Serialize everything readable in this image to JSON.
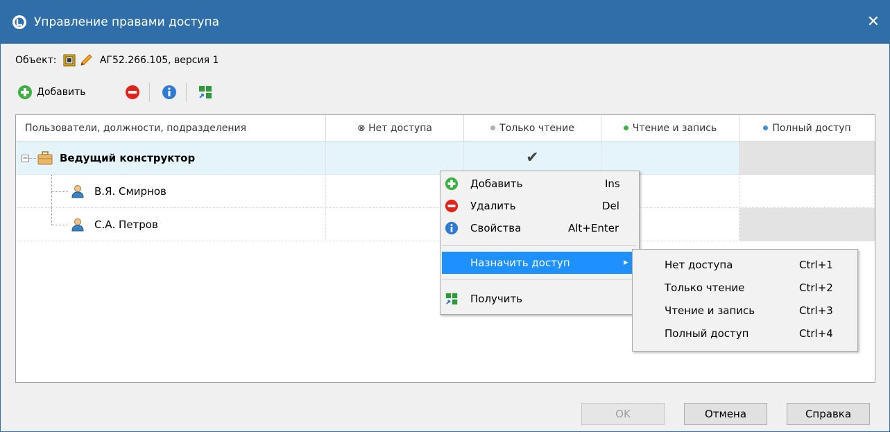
{
  "window": {
    "title": "Управление правами доступа",
    "close_glyph": "✕"
  },
  "object": {
    "label": "Объект:",
    "name": "АГ52.266.105, версия 1"
  },
  "toolbar": {
    "add_label": "Добавить"
  },
  "grid": {
    "columns": [
      "Пользователи, должности, подразделения",
      "⊗ Нет доступа",
      "Только чтение",
      "Чтение и запись",
      "Полный доступ"
    ],
    "rows": [
      {
        "name": "Ведущий конструктор",
        "check": "✔"
      },
      {
        "name": "В.Я. Смирнов"
      },
      {
        "name": "С.А. Петров"
      }
    ]
  },
  "context_menu": {
    "items": [
      {
        "label": "Добавить",
        "shortcut": "Ins"
      },
      {
        "label": "Удалить",
        "shortcut": "Del"
      },
      {
        "label": "Свойства",
        "shortcut": "Alt+Enter"
      },
      {
        "label": "Назначить доступ",
        "arrow": "▸"
      },
      {
        "label": "Получить"
      }
    ]
  },
  "submenu": {
    "items": [
      {
        "label": "Нет доступа",
        "shortcut": "Ctrl+1"
      },
      {
        "label": "Только чтение",
        "shortcut": "Ctrl+2"
      },
      {
        "label": "Чтение и запись",
        "shortcut": "Ctrl+3"
      },
      {
        "label": "Полный доступ",
        "shortcut": "Ctrl+4"
      }
    ]
  },
  "buttons": {
    "ok": "OK",
    "cancel": "Отмена",
    "help": "Справка"
  },
  "colors": {
    "titlebar": "#2f6ea8",
    "read_only_dot": "#b0b0b0",
    "read_write_dot": "#3cb043",
    "full_dot": "#3d8fd6",
    "selection": "#e5f3fb",
    "menu_highlight": "#1e90ff"
  }
}
